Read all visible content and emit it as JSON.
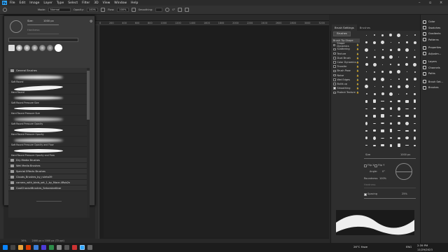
{
  "menubar": {
    "items": [
      "File",
      "Edit",
      "Image",
      "Layer",
      "Type",
      "Select",
      "Filter",
      "3D",
      "View",
      "Window",
      "Help"
    ]
  },
  "options": {
    "mode_label": "Mode:",
    "mode_value": "Normal",
    "opacity_label": "Opacity:",
    "opacity_value": "100%",
    "flow_label": "Flow:",
    "flow_value": "100%",
    "smoothing_label": "Smoothing:",
    "smoothing_value": "",
    "angle_value": "0°"
  },
  "brush_popup": {
    "size_label": "Size:",
    "size_value": "1000 px",
    "hardness_label": "Hardness:",
    "folder_general": "General Brushes",
    "strokes": [
      {
        "label": "Soft Round"
      },
      {
        "label": "Hard Round"
      },
      {
        "label": "Soft Round Pressure Size"
      },
      {
        "label": "Hard Round Pressure Size"
      },
      {
        "label": "Soft Round Pressure Opacity"
      },
      {
        "label": "Hard Round Pressure Opacity"
      },
      {
        "label": "Soft Round Pressure Opacity and Flow"
      },
      {
        "label": "Hard Round Pressure Opacity and Flow"
      }
    ],
    "folders": [
      "Dry Media Brushes",
      "Wet Media Brushes",
      "Special Effects Brushes",
      "Clouds_Brushes_by_ruleta39",
      "corners_with_birds_set_1_by_Mace-4Rob2n",
      "CoolCharactBrushes_Sekoraiantibar"
    ]
  },
  "brush_settings": {
    "tab_active": "Brush Settings",
    "tab_other": "Brushes",
    "brushes_button": "Brushes",
    "options": [
      {
        "label": "Brush Tip Shape",
        "checked": null
      },
      {
        "label": "Shape Dynamics",
        "checked": false
      },
      {
        "label": "Scattering",
        "checked": false
      },
      {
        "label": "Texture",
        "checked": false
      },
      {
        "label": "Dual Brush",
        "checked": false
      },
      {
        "label": "Color Dynamics",
        "checked": false
      },
      {
        "label": "Transfer",
        "checked": false
      },
      {
        "label": "Brush Pose",
        "checked": false
      },
      {
        "label": "Noise",
        "checked": false
      },
      {
        "label": "Wet Edges",
        "checked": false
      },
      {
        "label": "Build-up",
        "checked": false
      },
      {
        "label": "Smoothing",
        "checked": true
      },
      {
        "label": "Protect Texture",
        "checked": false
      }
    ],
    "size_label": "Size",
    "size_value": "1000 px",
    "flip_x": "Flip X",
    "flip_y": "Flip Y",
    "angle_label": "Angle:",
    "angle_value": "0°",
    "roundness_label": "Roundness:",
    "roundness_value": "100%",
    "hardness_label": "Hardness",
    "spacing_label": "Spacing",
    "spacing_value": "25%"
  },
  "right_panels": [
    "Color",
    "Swatches",
    "Gradients",
    "Patterns",
    "Properties",
    "Adjustm...",
    "Layers",
    "Channels",
    "Paths",
    "Brush Set...",
    "Brushes"
  ],
  "statusbar": {
    "zoom": "10%",
    "doc_info": "2000 px x 1000 px (72 ppi)"
  },
  "taskbar": {
    "weather": "26°C Haze",
    "lang": "ENG",
    "time": "2:39 PM",
    "date": "11/29/2023"
  }
}
